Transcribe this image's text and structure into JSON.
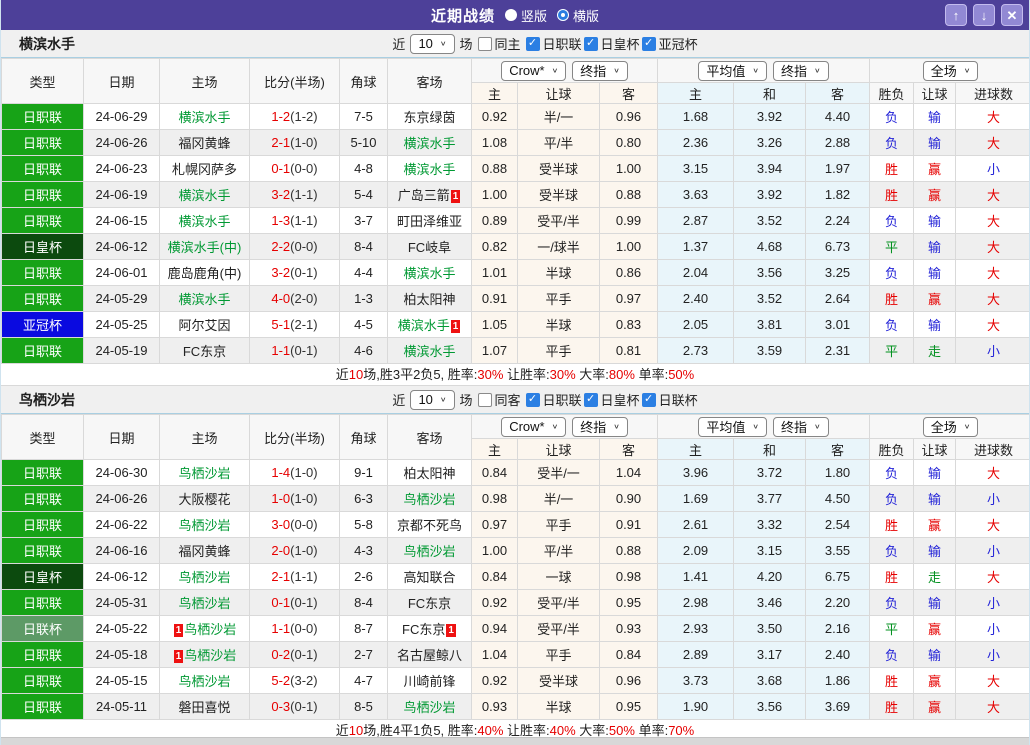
{
  "titlebar": {
    "title": "近期战绩",
    "radio_vertical": "竖版",
    "radio_horizontal": "横版",
    "selected_mode": "横版"
  },
  "icons": {
    "up": "↑",
    "down": "↓",
    "close": "✕",
    "chevron": "∨",
    "check": "✓"
  },
  "colors": {
    "titlebar": "#4d4099",
    "highlight_team": "#009933",
    "score_red": "#e60000",
    "result_red": "#e60000",
    "result_blue": "#2424d8",
    "result_green": "#00901e"
  },
  "type_colors": {
    "日职联": "#17a317",
    "日皇杯": "#0c4a0e",
    "亚冠杯": "#0a0ae0",
    "日联杯": "#5d9a66"
  },
  "filter_labels": {
    "near": "近",
    "games": "场"
  },
  "table_header": {
    "cols": [
      "类型",
      "日期",
      "主场",
      "比分(半场)",
      "角球",
      "客场"
    ],
    "crow_select": "Crow*",
    "final_select": "终指",
    "avg_select": "平均值",
    "scope_select": "全场",
    "sub_cols": [
      "主",
      "让球",
      "客",
      "主",
      "和",
      "客",
      "胜负",
      "让球",
      "进球数"
    ]
  },
  "sections": [
    {
      "team": "横滨水手",
      "filter": {
        "count": "10",
        "same_label": "同主",
        "same_checked": false,
        "leagues": [
          "日职联",
          "日皇杯",
          "亚冠杯"
        ]
      },
      "rows": [
        {
          "type": "日职联",
          "date": "24-06-29",
          "home": "横滨水手",
          "home_hl": true,
          "home_badge": "",
          "away": "东京绿茵",
          "away_hl": false,
          "away_badge": "",
          "score": "1-2",
          "half": "(1-2)",
          "corner": "7-5",
          "crow": [
            "0.92",
            "半/一",
            "0.96"
          ],
          "avg": [
            "1.68",
            "3.92",
            "4.40"
          ],
          "res": [
            [
              "负",
              "b"
            ],
            [
              "输",
              "b"
            ],
            [
              "大",
              "r"
            ]
          ]
        },
        {
          "type": "日职联",
          "date": "24-06-26",
          "home": "福冈黄蜂",
          "home_hl": false,
          "home_badge": "",
          "away": "横滨水手",
          "away_hl": true,
          "away_badge": "",
          "score": "2-1",
          "half": "(1-0)",
          "corner": "5-10",
          "crow": [
            "1.08",
            "平/半",
            "0.80"
          ],
          "avg": [
            "2.36",
            "3.26",
            "2.88"
          ],
          "res": [
            [
              "负",
              "b"
            ],
            [
              "输",
              "b"
            ],
            [
              "大",
              "r"
            ]
          ]
        },
        {
          "type": "日职联",
          "date": "24-06-23",
          "home": "札幌冈萨多",
          "home_hl": false,
          "home_badge": "",
          "away": "横滨水手",
          "away_hl": true,
          "away_badge": "",
          "score": "0-1",
          "half": "(0-0)",
          "corner": "4-8",
          "crow": [
            "0.88",
            "受半球",
            "1.00"
          ],
          "avg": [
            "3.15",
            "3.94",
            "1.97"
          ],
          "res": [
            [
              "胜",
              "r"
            ],
            [
              "赢",
              "r"
            ],
            [
              "小",
              "b"
            ]
          ]
        },
        {
          "type": "日职联",
          "date": "24-06-19",
          "home": "横滨水手",
          "home_hl": true,
          "home_badge": "",
          "away": "广岛三箭",
          "away_hl": false,
          "away_badge": "1",
          "score": "3-2",
          "half": "(1-1)",
          "corner": "5-4",
          "crow": [
            "1.00",
            "受半球",
            "0.88"
          ],
          "avg": [
            "3.63",
            "3.92",
            "1.82"
          ],
          "res": [
            [
              "胜",
              "r"
            ],
            [
              "赢",
              "r"
            ],
            [
              "大",
              "r"
            ]
          ]
        },
        {
          "type": "日职联",
          "date": "24-06-15",
          "home": "横滨水手",
          "home_hl": true,
          "home_badge": "",
          "away": "町田泽维亚",
          "away_hl": false,
          "away_badge": "",
          "score": "1-3",
          "half": "(1-1)",
          "corner": "3-7",
          "crow": [
            "0.89",
            "受平/半",
            "0.99"
          ],
          "avg": [
            "2.87",
            "3.52",
            "2.24"
          ],
          "res": [
            [
              "负",
              "b"
            ],
            [
              "输",
              "b"
            ],
            [
              "大",
              "r"
            ]
          ]
        },
        {
          "type": "日皇杯",
          "date": "24-06-12",
          "home": "横滨水手(中)",
          "home_hl": true,
          "home_badge": "",
          "away": "FC岐阜",
          "away_hl": false,
          "away_badge": "",
          "score": "2-2",
          "half": "(0-0)",
          "corner": "8-4",
          "crow": [
            "0.82",
            "一/球半",
            "1.00"
          ],
          "avg": [
            "1.37",
            "4.68",
            "6.73"
          ],
          "res": [
            [
              "平",
              "g"
            ],
            [
              "输",
              "b"
            ],
            [
              "大",
              "r"
            ]
          ]
        },
        {
          "type": "日职联",
          "date": "24-06-01",
          "home": "鹿岛鹿角(中)",
          "home_hl": false,
          "home_badge": "",
          "away": "横滨水手",
          "away_hl": true,
          "away_badge": "",
          "score": "3-2",
          "half": "(0-1)",
          "corner": "4-4",
          "crow": [
            "1.01",
            "半球",
            "0.86"
          ],
          "avg": [
            "2.04",
            "3.56",
            "3.25"
          ],
          "res": [
            [
              "负",
              "b"
            ],
            [
              "输",
              "b"
            ],
            [
              "大",
              "r"
            ]
          ]
        },
        {
          "type": "日职联",
          "date": "24-05-29",
          "home": "横滨水手",
          "home_hl": true,
          "home_badge": "",
          "away": "柏太阳神",
          "away_hl": false,
          "away_badge": "",
          "score": "4-0",
          "half": "(2-0)",
          "corner": "1-3",
          "crow": [
            "0.91",
            "平手",
            "0.97"
          ],
          "avg": [
            "2.40",
            "3.52",
            "2.64"
          ],
          "res": [
            [
              "胜",
              "r"
            ],
            [
              "赢",
              "r"
            ],
            [
              "大",
              "r"
            ]
          ]
        },
        {
          "type": "亚冠杯",
          "date": "24-05-25",
          "home": "阿尔艾因",
          "home_hl": false,
          "home_badge": "",
          "away": "横滨水手",
          "away_hl": true,
          "away_badge": "1",
          "score": "5-1",
          "half": "(2-1)",
          "corner": "4-5",
          "crow": [
            "1.05",
            "半球",
            "0.83"
          ],
          "avg": [
            "2.05",
            "3.81",
            "3.01"
          ],
          "res": [
            [
              "负",
              "b"
            ],
            [
              "输",
              "b"
            ],
            [
              "大",
              "r"
            ]
          ]
        },
        {
          "type": "日职联",
          "date": "24-05-19",
          "home": "FC东京",
          "home_hl": false,
          "home_badge": "",
          "away": "横滨水手",
          "away_hl": true,
          "away_badge": "",
          "score": "1-1",
          "half": "(0-1)",
          "corner": "4-6",
          "crow": [
            "1.07",
            "平手",
            "0.81"
          ],
          "avg": [
            "2.73",
            "3.59",
            "2.31"
          ],
          "res": [
            [
              "平",
              "g"
            ],
            [
              "走",
              "g"
            ],
            [
              "小",
              "b"
            ]
          ]
        }
      ],
      "summary": [
        {
          "t": "近",
          "c": "k"
        },
        {
          "t": "10",
          "c": "r"
        },
        {
          "t": "场,胜3平2负5, 胜率:",
          "c": "k"
        },
        {
          "t": "30%",
          "c": "r"
        },
        {
          "t": " 让胜率:",
          "c": "k"
        },
        {
          "t": "30%",
          "c": "r"
        },
        {
          "t": " 大率:",
          "c": "k"
        },
        {
          "t": "80%",
          "c": "r"
        },
        {
          "t": " 单率:",
          "c": "k"
        },
        {
          "t": "50%",
          "c": "r"
        }
      ]
    },
    {
      "team": "鸟栖沙岩",
      "filter": {
        "count": "10",
        "same_label": "同客",
        "same_checked": false,
        "leagues": [
          "日职联",
          "日皇杯",
          "日联杯"
        ]
      },
      "rows": [
        {
          "type": "日职联",
          "date": "24-06-30",
          "home": "鸟栖沙岩",
          "home_hl": true,
          "home_badge": "",
          "away": "柏太阳神",
          "away_hl": false,
          "away_badge": "",
          "score": "1-4",
          "half": "(1-0)",
          "corner": "9-1",
          "crow": [
            "0.84",
            "受半/一",
            "1.04"
          ],
          "avg": [
            "3.96",
            "3.72",
            "1.80"
          ],
          "res": [
            [
              "负",
              "b"
            ],
            [
              "输",
              "b"
            ],
            [
              "大",
              "r"
            ]
          ]
        },
        {
          "type": "日职联",
          "date": "24-06-26",
          "home": "大阪樱花",
          "home_hl": false,
          "home_badge": "",
          "away": "鸟栖沙岩",
          "away_hl": true,
          "away_badge": "",
          "score": "1-0",
          "half": "(1-0)",
          "corner": "6-3",
          "crow": [
            "0.98",
            "半/一",
            "0.90"
          ],
          "avg": [
            "1.69",
            "3.77",
            "4.50"
          ],
          "res": [
            [
              "负",
              "b"
            ],
            [
              "输",
              "b"
            ],
            [
              "小",
              "b"
            ]
          ]
        },
        {
          "type": "日职联",
          "date": "24-06-22",
          "home": "鸟栖沙岩",
          "home_hl": true,
          "home_badge": "",
          "away": "京都不死鸟",
          "away_hl": false,
          "away_badge": "",
          "score": "3-0",
          "half": "(0-0)",
          "corner": "5-8",
          "crow": [
            "0.97",
            "平手",
            "0.91"
          ],
          "avg": [
            "2.61",
            "3.32",
            "2.54"
          ],
          "res": [
            [
              "胜",
              "r"
            ],
            [
              "赢",
              "r"
            ],
            [
              "大",
              "r"
            ]
          ]
        },
        {
          "type": "日职联",
          "date": "24-06-16",
          "home": "福冈黄蜂",
          "home_hl": false,
          "home_badge": "",
          "away": "鸟栖沙岩",
          "away_hl": true,
          "away_badge": "",
          "score": "2-0",
          "half": "(1-0)",
          "corner": "4-3",
          "crow": [
            "1.00",
            "平/半",
            "0.88"
          ],
          "avg": [
            "2.09",
            "3.15",
            "3.55"
          ],
          "res": [
            [
              "负",
              "b"
            ],
            [
              "输",
              "b"
            ],
            [
              "小",
              "b"
            ]
          ]
        },
        {
          "type": "日皇杯",
          "date": "24-06-12",
          "home": "鸟栖沙岩",
          "home_hl": true,
          "home_badge": "",
          "away": "高知联合",
          "away_hl": false,
          "away_badge": "",
          "score": "2-1",
          "half": "(1-1)",
          "corner": "2-6",
          "crow": [
            "0.84",
            "一球",
            "0.98"
          ],
          "avg": [
            "1.41",
            "4.20",
            "6.75"
          ],
          "res": [
            [
              "胜",
              "r"
            ],
            [
              "走",
              "g"
            ],
            [
              "大",
              "r"
            ]
          ]
        },
        {
          "type": "日职联",
          "date": "24-05-31",
          "home": "鸟栖沙岩",
          "home_hl": true,
          "home_badge": "",
          "away": "FC东京",
          "away_hl": false,
          "away_badge": "",
          "score": "0-1",
          "half": "(0-1)",
          "corner": "8-4",
          "crow": [
            "0.92",
            "受平/半",
            "0.95"
          ],
          "avg": [
            "2.98",
            "3.46",
            "2.20"
          ],
          "res": [
            [
              "负",
              "b"
            ],
            [
              "输",
              "b"
            ],
            [
              "小",
              "b"
            ]
          ]
        },
        {
          "type": "日联杯",
          "date": "24-05-22",
          "home": "鸟栖沙岩",
          "home_hl": true,
          "home_badge": "1",
          "away": "FC东京",
          "away_hl": false,
          "away_badge": "1",
          "score": "1-1",
          "half": "(0-0)",
          "corner": "8-7",
          "crow": [
            "0.94",
            "受平/半",
            "0.93"
          ],
          "avg": [
            "2.93",
            "3.50",
            "2.16"
          ],
          "res": [
            [
              "平",
              "g"
            ],
            [
              "赢",
              "r"
            ],
            [
              "小",
              "b"
            ]
          ]
        },
        {
          "type": "日职联",
          "date": "24-05-18",
          "home": "鸟栖沙岩",
          "home_hl": true,
          "home_badge": "1",
          "away": "名古屋鲸八",
          "away_hl": false,
          "away_badge": "",
          "score": "0-2",
          "half": "(0-1)",
          "corner": "2-7",
          "crow": [
            "1.04",
            "平手",
            "0.84"
          ],
          "avg": [
            "2.89",
            "3.17",
            "2.40"
          ],
          "res": [
            [
              "负",
              "b"
            ],
            [
              "输",
              "b"
            ],
            [
              "小",
              "b"
            ]
          ]
        },
        {
          "type": "日职联",
          "date": "24-05-15",
          "home": "鸟栖沙岩",
          "home_hl": true,
          "home_badge": "",
          "away": "川崎前锋",
          "away_hl": false,
          "away_badge": "",
          "score": "5-2",
          "half": "(3-2)",
          "corner": "4-7",
          "crow": [
            "0.92",
            "受半球",
            "0.96"
          ],
          "avg": [
            "3.73",
            "3.68",
            "1.86"
          ],
          "res": [
            [
              "胜",
              "r"
            ],
            [
              "赢",
              "r"
            ],
            [
              "大",
              "r"
            ]
          ]
        },
        {
          "type": "日职联",
          "date": "24-05-11",
          "home": "磐田喜悦",
          "home_hl": false,
          "home_badge": "",
          "away": "鸟栖沙岩",
          "away_hl": true,
          "away_badge": "",
          "score": "0-3",
          "half": "(0-1)",
          "corner": "8-5",
          "crow": [
            "0.93",
            "半球",
            "0.95"
          ],
          "avg": [
            "1.90",
            "3.56",
            "3.69"
          ],
          "res": [
            [
              "胜",
              "r"
            ],
            [
              "赢",
              "r"
            ],
            [
              "大",
              "r"
            ]
          ]
        }
      ],
      "summary": [
        {
          "t": "近",
          "c": "k"
        },
        {
          "t": "10",
          "c": "r"
        },
        {
          "t": "场,胜4平1负5, 胜率:",
          "c": "k"
        },
        {
          "t": "40%",
          "c": "r"
        },
        {
          "t": " 让胜率:",
          "c": "k"
        },
        {
          "t": "40%",
          "c": "r"
        },
        {
          "t": " 大率:",
          "c": "k"
        },
        {
          "t": "50%",
          "c": "r"
        },
        {
          "t": " 单率:",
          "c": "k"
        },
        {
          "t": "70%",
          "c": "r"
        }
      ]
    }
  ]
}
